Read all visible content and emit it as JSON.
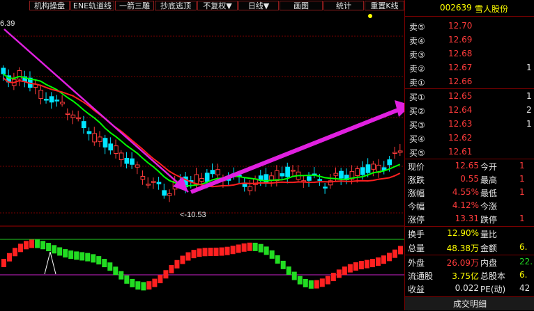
{
  "toolbar": {
    "items": [
      "机构操盘",
      "ENE轨道线",
      "一箭三雕",
      "抄底逃顶",
      "不复权▼",
      "日线▼",
      "画图",
      "统计",
      "重置K线"
    ]
  },
  "chart": {
    "high_label": "6.39",
    "low_label": "<-10.53"
  },
  "stock": {
    "code": "002639",
    "name": "雪人股份"
  },
  "order_book": {
    "sell": [
      {
        "label": "卖⑤",
        "price": "12.70",
        "vol": ""
      },
      {
        "label": "卖④",
        "price": "12.69",
        "vol": ""
      },
      {
        "label": "卖③",
        "price": "12.68",
        "vol": ""
      },
      {
        "label": "卖②",
        "price": "12.67",
        "vol": "1"
      },
      {
        "label": "卖①",
        "price": "12.66",
        "vol": ""
      }
    ],
    "buy": [
      {
        "label": "买①",
        "price": "12.65",
        "vol": "1"
      },
      {
        "label": "买②",
        "price": "12.64",
        "vol": "2"
      },
      {
        "label": "买③",
        "price": "12.63",
        "vol": "1"
      },
      {
        "label": "买④",
        "price": "12.62",
        "vol": ""
      },
      {
        "label": "买⑤",
        "price": "12.61",
        "vol": ""
      }
    ]
  },
  "quote": [
    {
      "l1": "现价",
      "v1": "12.65",
      "l2": "今开",
      "v2": "1"
    },
    {
      "l1": "涨跌",
      "v1": "0.55",
      "l2": "最高",
      "v2": "1"
    },
    {
      "l1": "涨幅",
      "v1": "4.55%",
      "l2": "最低",
      "v2": "1"
    },
    {
      "l1": "今幅",
      "v1": "4.12%",
      "l2": "今涨",
      "v2": ""
    },
    {
      "l1": "涨停",
      "v1": "13.31",
      "l2": "跌停",
      "v2": "1"
    },
    {
      "l1": "换手",
      "v1": "12.90%",
      "l2": "量比",
      "v2": ""
    },
    {
      "l1": "总量",
      "v1": "48.38万",
      "l2": "金额",
      "v2": "6."
    },
    {
      "l1": "外盘",
      "v1": "26.09万",
      "l2": "内盘",
      "v2": "22."
    },
    {
      "l1": "流通股",
      "v1": "3.75亿",
      "l2": "总股本",
      "v2": "6."
    },
    {
      "l1": "收益",
      "v1": "0.022",
      "l2": "PE(动)",
      "v2": "42"
    }
  ],
  "detail_label": "成交明细",
  "colors": {
    "up": "#ff3b3b",
    "down": "#00e5ff",
    "ma_green": "#00ff00",
    "ma_red": "#ff2020",
    "arrow": "#e020e0",
    "osc_up": "#ff2020",
    "osc_down": "#22dd22",
    "text_yellow": "#ffff00"
  }
}
